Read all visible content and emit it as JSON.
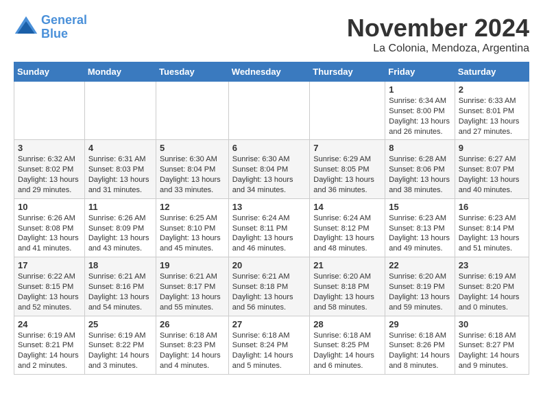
{
  "header": {
    "logo_line1": "General",
    "logo_line2": "Blue",
    "month": "November 2024",
    "location": "La Colonia, Mendoza, Argentina"
  },
  "weekdays": [
    "Sunday",
    "Monday",
    "Tuesday",
    "Wednesday",
    "Thursday",
    "Friday",
    "Saturday"
  ],
  "weeks": [
    [
      {
        "day": "",
        "text": ""
      },
      {
        "day": "",
        "text": ""
      },
      {
        "day": "",
        "text": ""
      },
      {
        "day": "",
        "text": ""
      },
      {
        "day": "",
        "text": ""
      },
      {
        "day": "1",
        "text": "Sunrise: 6:34 AM\nSunset: 8:00 PM\nDaylight: 13 hours and 26 minutes."
      },
      {
        "day": "2",
        "text": "Sunrise: 6:33 AM\nSunset: 8:01 PM\nDaylight: 13 hours and 27 minutes."
      }
    ],
    [
      {
        "day": "3",
        "text": "Sunrise: 6:32 AM\nSunset: 8:02 PM\nDaylight: 13 hours and 29 minutes."
      },
      {
        "day": "4",
        "text": "Sunrise: 6:31 AM\nSunset: 8:03 PM\nDaylight: 13 hours and 31 minutes."
      },
      {
        "day": "5",
        "text": "Sunrise: 6:30 AM\nSunset: 8:04 PM\nDaylight: 13 hours and 33 minutes."
      },
      {
        "day": "6",
        "text": "Sunrise: 6:30 AM\nSunset: 8:04 PM\nDaylight: 13 hours and 34 minutes."
      },
      {
        "day": "7",
        "text": "Sunrise: 6:29 AM\nSunset: 8:05 PM\nDaylight: 13 hours and 36 minutes."
      },
      {
        "day": "8",
        "text": "Sunrise: 6:28 AM\nSunset: 8:06 PM\nDaylight: 13 hours and 38 minutes."
      },
      {
        "day": "9",
        "text": "Sunrise: 6:27 AM\nSunset: 8:07 PM\nDaylight: 13 hours and 40 minutes."
      }
    ],
    [
      {
        "day": "10",
        "text": "Sunrise: 6:26 AM\nSunset: 8:08 PM\nDaylight: 13 hours and 41 minutes."
      },
      {
        "day": "11",
        "text": "Sunrise: 6:26 AM\nSunset: 8:09 PM\nDaylight: 13 hours and 43 minutes."
      },
      {
        "day": "12",
        "text": "Sunrise: 6:25 AM\nSunset: 8:10 PM\nDaylight: 13 hours and 45 minutes."
      },
      {
        "day": "13",
        "text": "Sunrise: 6:24 AM\nSunset: 8:11 PM\nDaylight: 13 hours and 46 minutes."
      },
      {
        "day": "14",
        "text": "Sunrise: 6:24 AM\nSunset: 8:12 PM\nDaylight: 13 hours and 48 minutes."
      },
      {
        "day": "15",
        "text": "Sunrise: 6:23 AM\nSunset: 8:13 PM\nDaylight: 13 hours and 49 minutes."
      },
      {
        "day": "16",
        "text": "Sunrise: 6:23 AM\nSunset: 8:14 PM\nDaylight: 13 hours and 51 minutes."
      }
    ],
    [
      {
        "day": "17",
        "text": "Sunrise: 6:22 AM\nSunset: 8:15 PM\nDaylight: 13 hours and 52 minutes."
      },
      {
        "day": "18",
        "text": "Sunrise: 6:21 AM\nSunset: 8:16 PM\nDaylight: 13 hours and 54 minutes."
      },
      {
        "day": "19",
        "text": "Sunrise: 6:21 AM\nSunset: 8:17 PM\nDaylight: 13 hours and 55 minutes."
      },
      {
        "day": "20",
        "text": "Sunrise: 6:21 AM\nSunset: 8:18 PM\nDaylight: 13 hours and 56 minutes."
      },
      {
        "day": "21",
        "text": "Sunrise: 6:20 AM\nSunset: 8:18 PM\nDaylight: 13 hours and 58 minutes."
      },
      {
        "day": "22",
        "text": "Sunrise: 6:20 AM\nSunset: 8:19 PM\nDaylight: 13 hours and 59 minutes."
      },
      {
        "day": "23",
        "text": "Sunrise: 6:19 AM\nSunset: 8:20 PM\nDaylight: 14 hours and 0 minutes."
      }
    ],
    [
      {
        "day": "24",
        "text": "Sunrise: 6:19 AM\nSunset: 8:21 PM\nDaylight: 14 hours and 2 minutes."
      },
      {
        "day": "25",
        "text": "Sunrise: 6:19 AM\nSunset: 8:22 PM\nDaylight: 14 hours and 3 minutes."
      },
      {
        "day": "26",
        "text": "Sunrise: 6:18 AM\nSunset: 8:23 PM\nDaylight: 14 hours and 4 minutes."
      },
      {
        "day": "27",
        "text": "Sunrise: 6:18 AM\nSunset: 8:24 PM\nDaylight: 14 hours and 5 minutes."
      },
      {
        "day": "28",
        "text": "Sunrise: 6:18 AM\nSunset: 8:25 PM\nDaylight: 14 hours and 6 minutes."
      },
      {
        "day": "29",
        "text": "Sunrise: 6:18 AM\nSunset: 8:26 PM\nDaylight: 14 hours and 8 minutes."
      },
      {
        "day": "30",
        "text": "Sunrise: 6:18 AM\nSunset: 8:27 PM\nDaylight: 14 hours and 9 minutes."
      }
    ]
  ]
}
